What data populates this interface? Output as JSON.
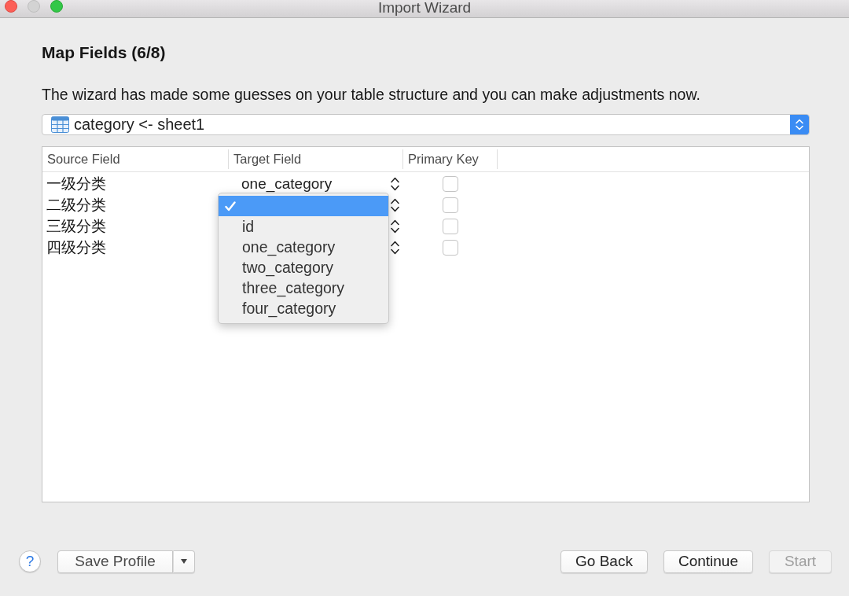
{
  "window": {
    "title": "Import Wizard",
    "controls": [
      {
        "kind": "close",
        "disabled": false
      },
      {
        "kind": "minimize",
        "disabled": true
      },
      {
        "kind": "zoom",
        "disabled": false
      }
    ]
  },
  "heading": "Map Fields (6/8)",
  "description": "The wizard has made some guesses on your table structure and you can make adjustments now.",
  "table_selector": {
    "value": "category <- sheet1"
  },
  "mapping_table": {
    "columns": [
      "Source Field",
      "Target Field",
      "Primary Key"
    ],
    "rows": [
      {
        "source": "一级分类",
        "target": "one_category",
        "primary_key": false
      },
      {
        "source": "二级分类",
        "primary_key": false,
        "menu": {
          "items": [
            {
              "selected": true
            },
            {
              "label": "id",
              "selected": false
            },
            {
              "label": "one_category",
              "selected": false
            },
            {
              "label": "two_category",
              "selected": false
            },
            {
              "label": "three_category",
              "selected": false
            },
            {
              "label": "four_category",
              "selected": false
            }
          ]
        }
      },
      {
        "source": "三级分类",
        "primary_key": false
      },
      {
        "source": "四级分类",
        "primary_key": false
      }
    ]
  },
  "footer": {
    "help_button": {
      "label": "?"
    },
    "save_profile_button": {
      "label": "Save Profile"
    },
    "buttons": [
      {
        "label": "Go Back",
        "disabled": false
      },
      {
        "label": "Continue",
        "disabled": false
      },
      {
        "label": "Start",
        "disabled": true
      }
    ]
  }
}
